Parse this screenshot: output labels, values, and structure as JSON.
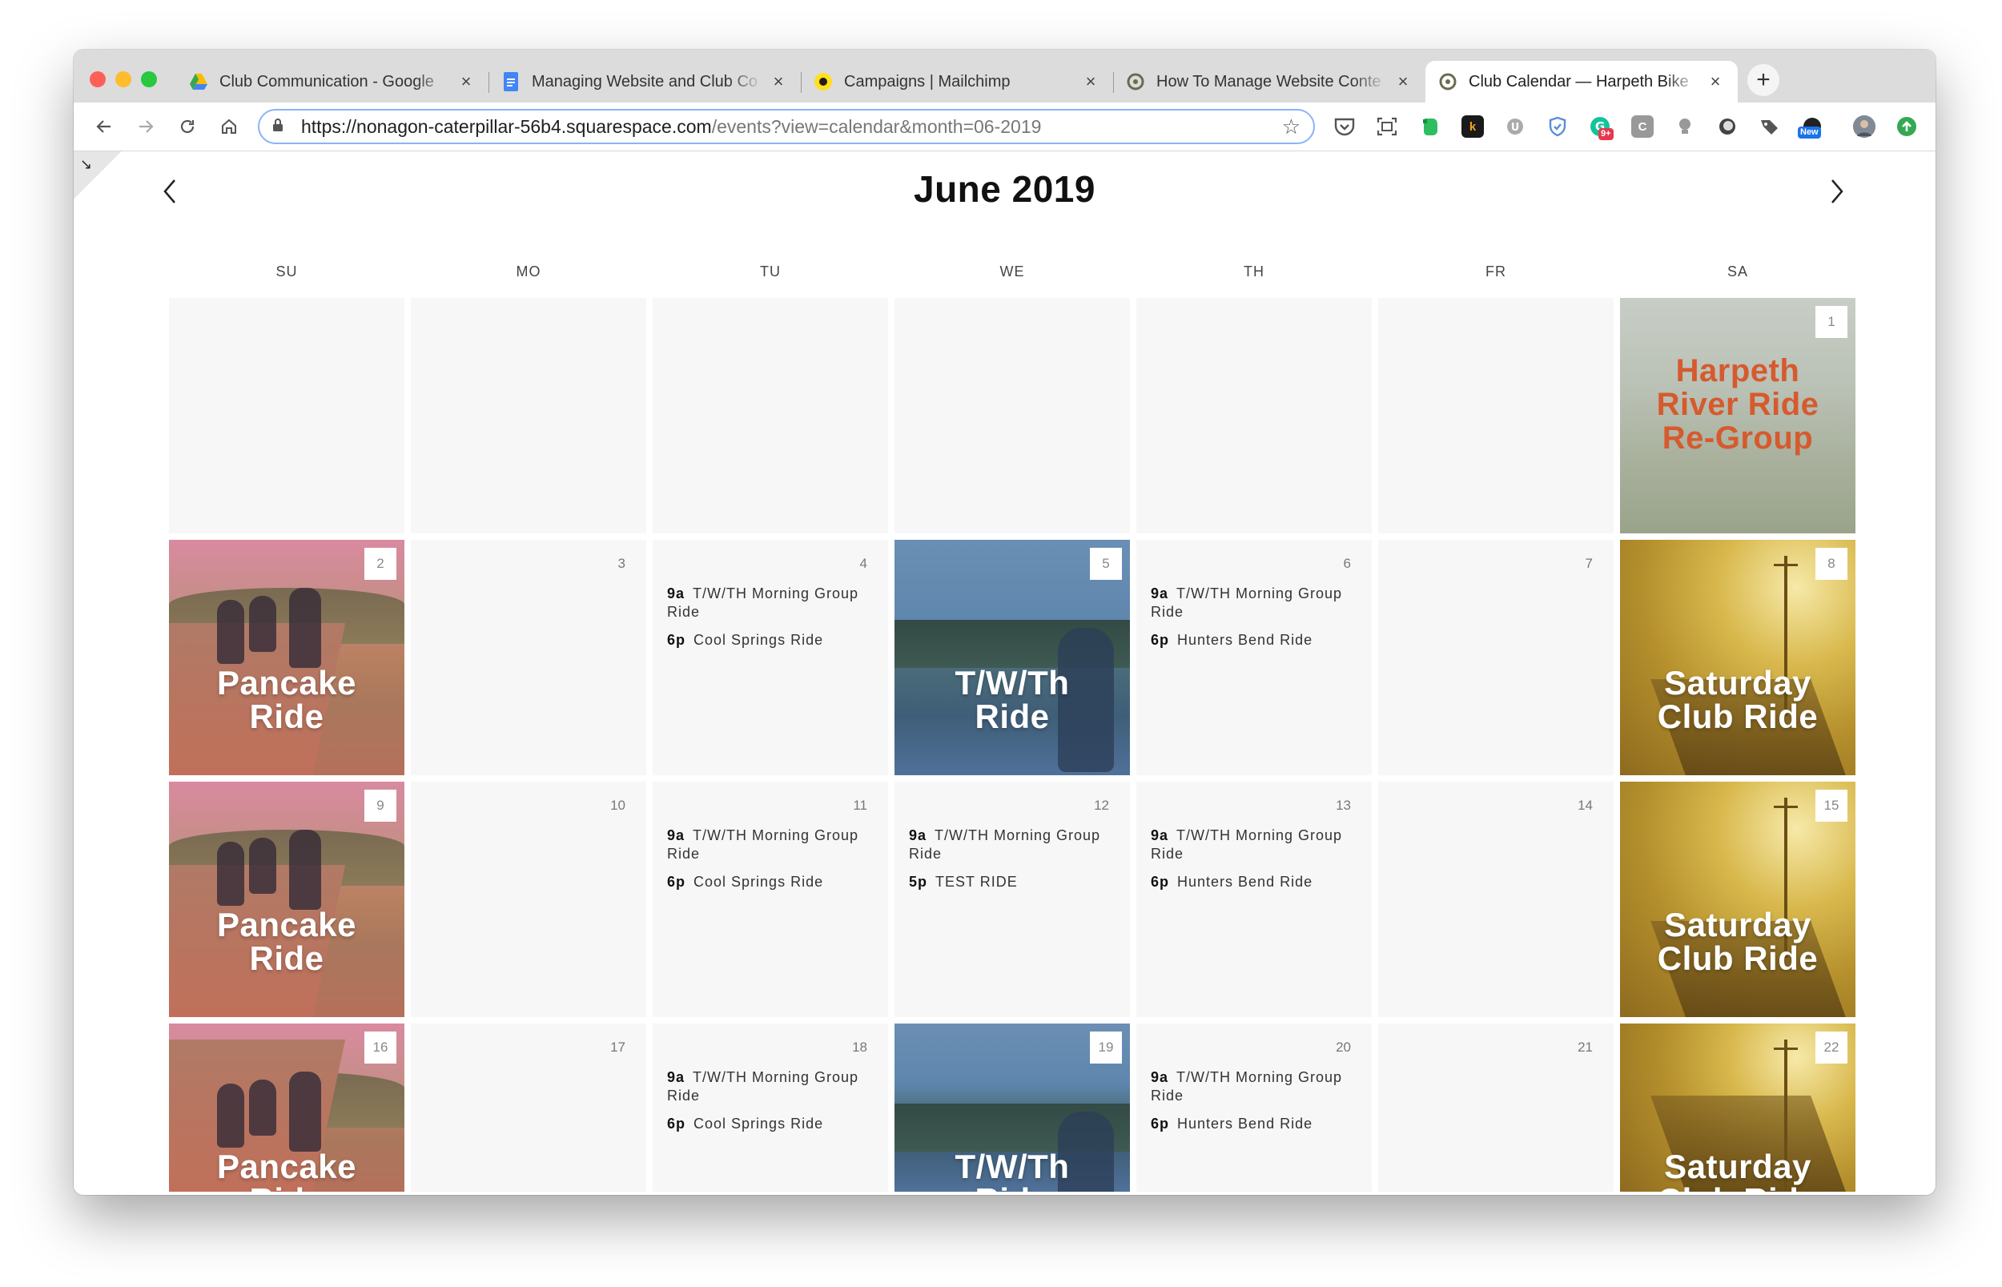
{
  "browser": {
    "tabs": [
      {
        "title": "Club Communication - Google",
        "favicon": "google-drive-icon",
        "active": false
      },
      {
        "title": "Managing Website and Club Co",
        "favicon": "google-docs-icon",
        "active": false
      },
      {
        "title": "Campaigns | Mailchimp",
        "favicon": "mailchimp-icon",
        "active": false
      },
      {
        "title": "How To Manage Website Conte",
        "favicon": "site-icon",
        "active": false
      },
      {
        "title": "Club Calendar — Harpeth Bike",
        "favicon": "site-icon",
        "active": true
      }
    ],
    "new_tab": "+",
    "url_host": "https://nonagon-caterpillar-56b4.squarespace.com",
    "url_path": "/events?view=calendar&month=06-2019",
    "extension_badges": {
      "grammarly": "9+",
      "new": "New"
    }
  },
  "calendar": {
    "month_title": "June 2019",
    "prev": "‹",
    "next": "›",
    "weekdays": [
      "SU",
      "MO",
      "TU",
      "WE",
      "TH",
      "FR",
      "SA"
    ],
    "weeks": [
      [
        {
          "day": ""
        },
        {
          "day": ""
        },
        {
          "day": ""
        },
        {
          "day": ""
        },
        {
          "day": ""
        },
        {
          "day": ""
        },
        {
          "day": "1",
          "art": "river",
          "art_title": "Harpeth River Ride Re-Group"
        }
      ],
      [
        {
          "day": "2",
          "art": "pancake",
          "art_title": "Pancake Ride"
        },
        {
          "day": "3"
        },
        {
          "day": "4",
          "events": [
            {
              "time": "9a",
              "name": "T/W/TH Morning Group Ride"
            },
            {
              "time": "6p",
              "name": "Cool Springs Ride"
            }
          ]
        },
        {
          "day": "5",
          "art": "tw",
          "art_title": "T/W/Th Ride"
        },
        {
          "day": "6",
          "events": [
            {
              "time": "9a",
              "name": "T/W/TH Morning Group Ride"
            },
            {
              "time": "6p",
              "name": "Hunters Bend Ride"
            }
          ]
        },
        {
          "day": "7"
        },
        {
          "day": "8",
          "art": "sat",
          "art_title": "Saturday Club Ride"
        }
      ],
      [
        {
          "day": "9",
          "art": "pancake",
          "art_title": "Pancake Ride"
        },
        {
          "day": "10"
        },
        {
          "day": "11",
          "events": [
            {
              "time": "9a",
              "name": "T/W/TH Morning Group Ride"
            },
            {
              "time": "6p",
              "name": "Cool Springs Ride"
            }
          ]
        },
        {
          "day": "12",
          "events": [
            {
              "time": "9a",
              "name": "T/W/TH Morning Group Ride"
            },
            {
              "time": "5p",
              "name": "TEST RIDE"
            }
          ]
        },
        {
          "day": "13",
          "events": [
            {
              "time": "9a",
              "name": "T/W/TH Morning Group Ride"
            },
            {
              "time": "6p",
              "name": "Hunters Bend Ride"
            }
          ]
        },
        {
          "day": "14"
        },
        {
          "day": "15",
          "art": "sat",
          "art_title": "Saturday Club Ride"
        }
      ],
      [
        {
          "day": "16",
          "art": "pancake",
          "art_title": "Pancake Ride"
        },
        {
          "day": "17"
        },
        {
          "day": "18",
          "events": [
            {
              "time": "9a",
              "name": "T/W/TH Morning Group Ride"
            },
            {
              "time": "6p",
              "name": "Cool Springs Ride"
            }
          ]
        },
        {
          "day": "19",
          "art": "tw",
          "art_title": "T/W/Th Ride"
        },
        {
          "day": "20",
          "events": [
            {
              "time": "9a",
              "name": "T/W/TH Morning Group Ride"
            },
            {
              "time": "6p",
              "name": "Hunters Bend Ride"
            }
          ]
        },
        {
          "day": "21"
        },
        {
          "day": "22",
          "art": "sat",
          "art_title": "Saturday Club Ride"
        }
      ]
    ]
  },
  "colors": {
    "accent_blue": "#8ab4f8",
    "river_title": "#d65a2e",
    "cell_bg": "#f7f7f7"
  }
}
